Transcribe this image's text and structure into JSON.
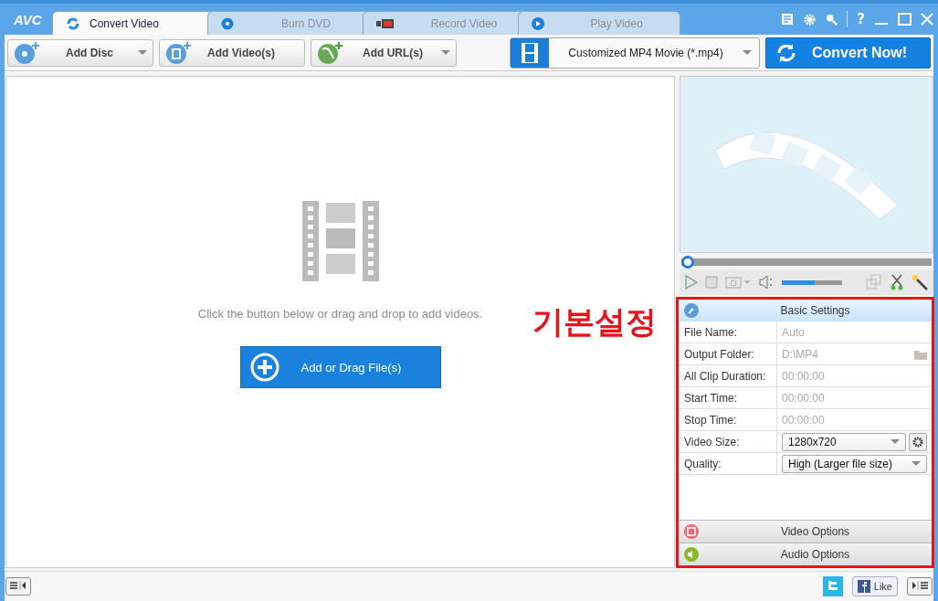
{
  "app_logo": "AVC",
  "tabs": [
    {
      "label": "Convert Video",
      "selected": true,
      "kind": "convert"
    },
    {
      "label": "Burn DVD",
      "selected": false,
      "kind": "disc"
    },
    {
      "label": "Record Video",
      "selected": false,
      "kind": "record"
    },
    {
      "label": "Play Video",
      "selected": false,
      "kind": "play"
    }
  ],
  "help": "?",
  "toolbar": {
    "buttons": [
      {
        "label": "Add Disc",
        "kind": "disc",
        "dropdown": true
      },
      {
        "label": "Add Video(s)",
        "kind": "film",
        "dropdown": false
      },
      {
        "label": "Add URL(s)",
        "kind": "globe",
        "dropdown": true
      }
    ],
    "profile": "Customized MP4 Movie (*.mp4)",
    "convert": "Convert Now!"
  },
  "drop_area": {
    "hint": "Click the button below or drag and drop to add videos.",
    "button": "Add or Drag File(s)"
  },
  "player": {
    "seek": {
      "level": 0.0
    },
    "volume": {
      "level": 0.55
    }
  },
  "annotation": {
    "text": "기본설정"
  },
  "settings": {
    "title": "Basic Settings",
    "rows": [
      {
        "label": "File Name:",
        "value": "Auto",
        "kind": "text"
      },
      {
        "label": "Output Folder:",
        "value": "D:\\MP4",
        "kind": "folder"
      },
      {
        "label": "All Clip Duration:",
        "value": "00:00:00",
        "kind": "text"
      },
      {
        "label": "Start Time:",
        "value": "00:00:00",
        "kind": "text"
      },
      {
        "label": "Stop Time:",
        "value": "00:00:00",
        "kind": "text"
      },
      {
        "label": "Video Size:",
        "value": "1280x720",
        "kind": "select_gear"
      },
      {
        "label": "Quality:",
        "value": "High (Larger file size)",
        "kind": "select"
      }
    ],
    "sections": [
      {
        "label": "Video Options",
        "kind": "video"
      },
      {
        "label": "Audio Options",
        "kind": "audio"
      }
    ]
  },
  "status_bar": {
    "like": "Like"
  }
}
